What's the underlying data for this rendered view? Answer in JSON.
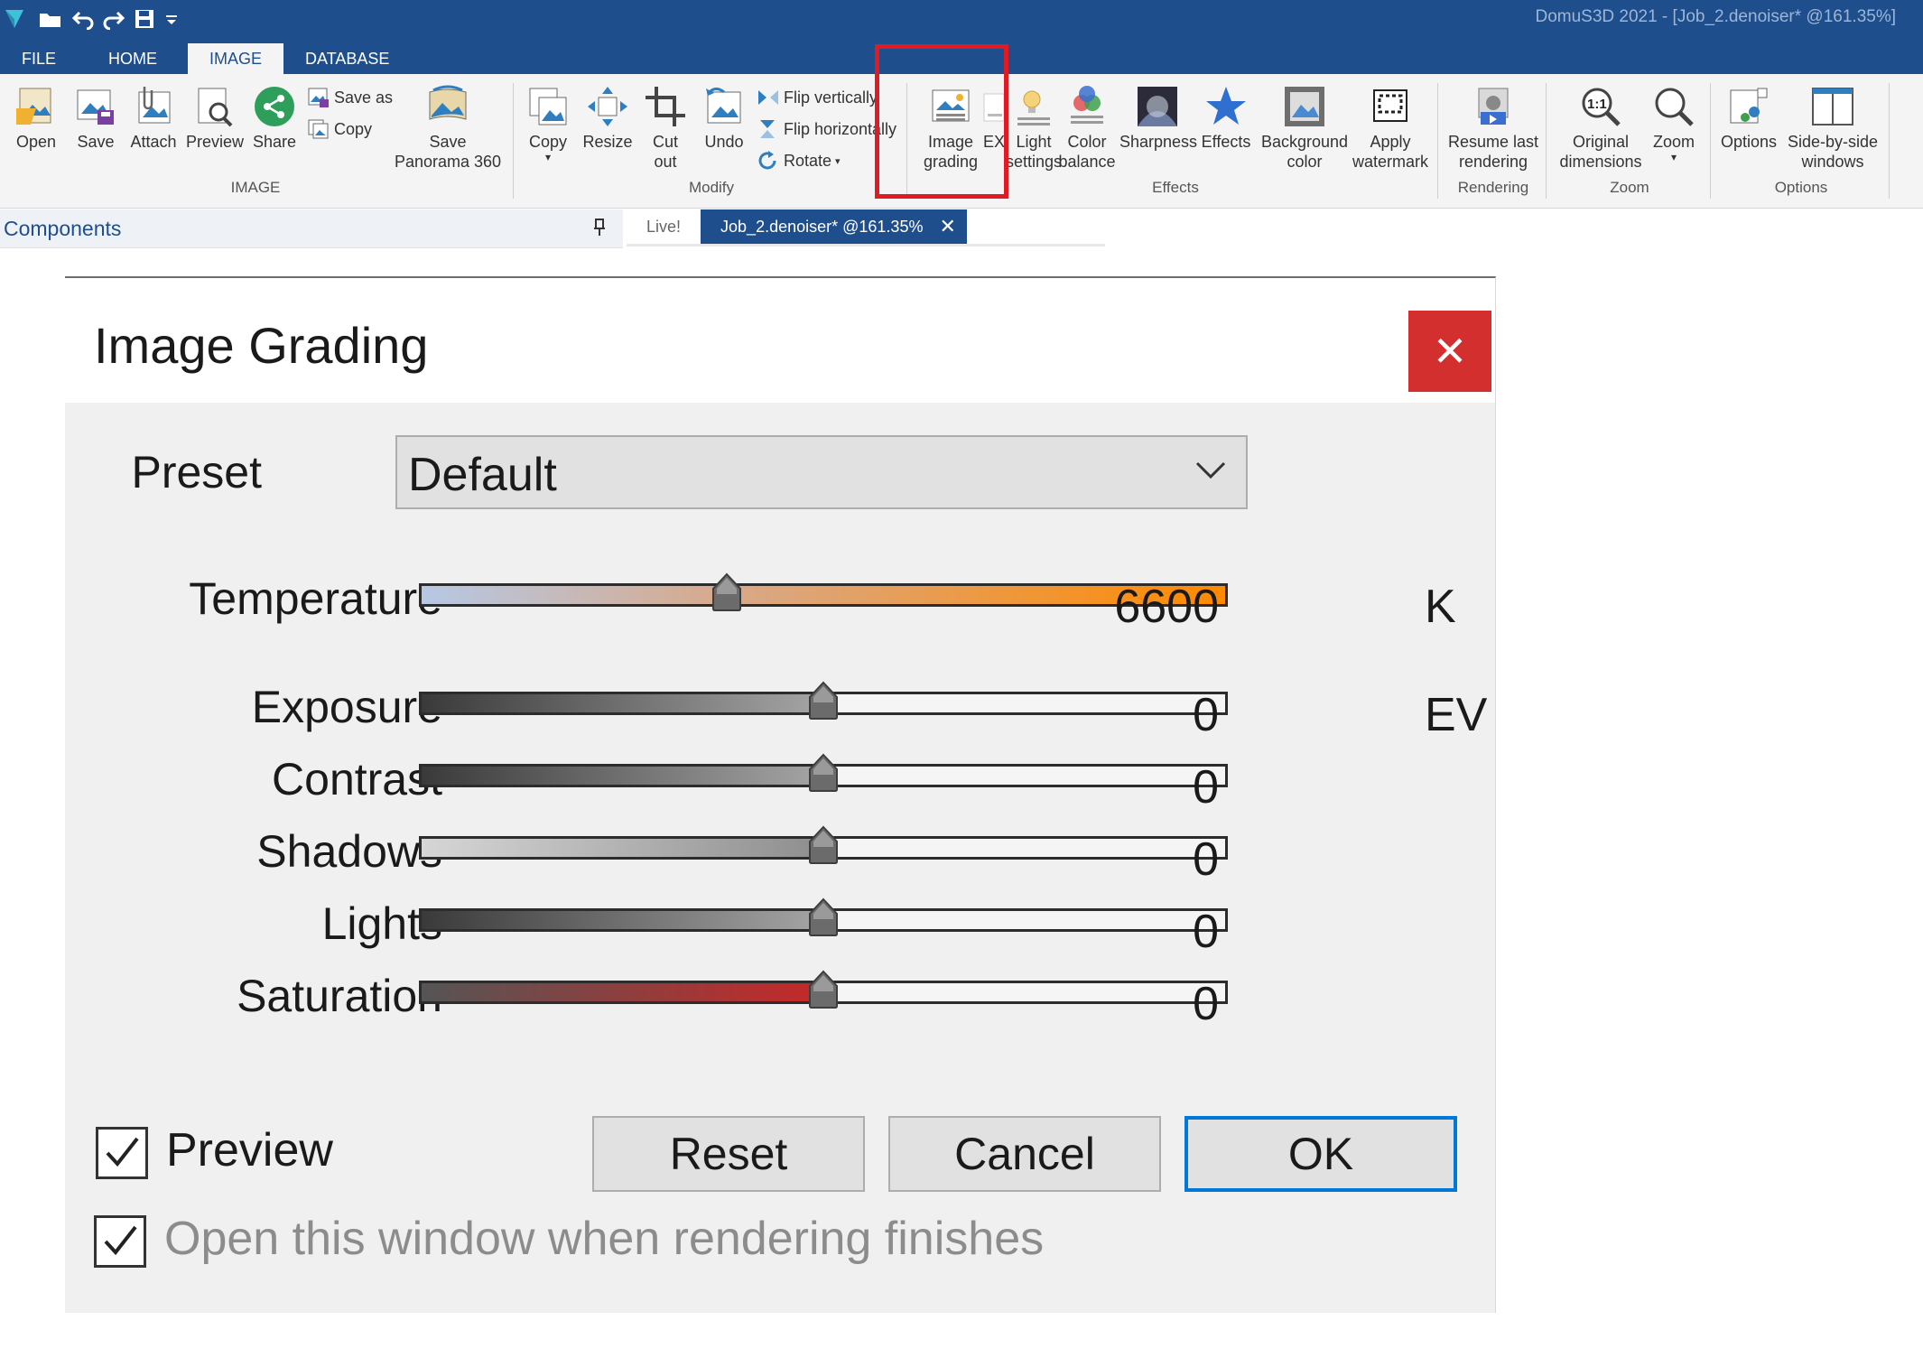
{
  "app": {
    "window_title": "DomuS3D 2021 - [Job_2.denoiser* @161.35%]"
  },
  "menu": {
    "tabs": [
      "FILE",
      "HOME",
      "IMAGE",
      "DATABASE"
    ],
    "active": "IMAGE"
  },
  "ribbon": {
    "image_group": {
      "label": "IMAGE",
      "open": "Open",
      "save": "Save",
      "attach": "Attach",
      "preview": "Preview",
      "share": "Share",
      "save_as": "Save as",
      "copy_small": "Copy",
      "save_panorama": "Save\nPanorama 360"
    },
    "modify_group": {
      "label": "Modify",
      "copy": "Copy",
      "resize": "Resize",
      "cut_out": "Cut\nout",
      "undo": "Undo",
      "flip_vertically": "Flip vertically",
      "flip_horizontally": "Flip horizontally",
      "rotate": "Rotate"
    },
    "effects_group": {
      "label": "Effects",
      "image_grading": "Image\ngrading",
      "exif": "EX",
      "light_settings": "Light\nsettings",
      "color_balance": "Color\nbalance",
      "sharpness": "Sharpness",
      "effects": "Effects",
      "background_color": "Background\ncolor",
      "apply_watermark": "Apply\nwatermark"
    },
    "rendering_group": {
      "label": "Rendering",
      "resume_last_rendering": "Resume last\nrendering"
    },
    "zoom_group": {
      "label": "Zoom",
      "original_dimensions": "Original\ndimensions",
      "zoom": "Zoom"
    },
    "options_group": {
      "label": "Options",
      "options": "Options",
      "side_by_side": "Side-by-side\nwindows"
    }
  },
  "components_panel": {
    "title": "Components"
  },
  "doc_tabs": {
    "live": "Live!",
    "active": "Job_2.denoiser* @161.35%"
  },
  "dialog": {
    "title": "Image Grading",
    "preset": {
      "label": "Preset",
      "value": "Default"
    },
    "sliders": [
      {
        "label": "Temperature",
        "value": "6600",
        "unit": "K",
        "position": 0.38
      },
      {
        "label": "Exposure",
        "value": "0",
        "unit": "EV",
        "position": 0.5
      },
      {
        "label": "Contrast",
        "value": "0",
        "unit": "",
        "position": 0.5
      },
      {
        "label": "Shadows",
        "value": "0",
        "unit": "",
        "position": 0.5
      },
      {
        "label": "Lights",
        "value": "0",
        "unit": "",
        "position": 0.5
      },
      {
        "label": "Saturation",
        "value": "0",
        "unit": "",
        "position": 0.5
      }
    ],
    "preview_checkbox": {
      "label": "Preview",
      "checked": true
    },
    "open_on_finish_checkbox": {
      "label": "Open this window when rendering finishes",
      "checked": true
    },
    "buttons": {
      "reset": "Reset",
      "cancel": "Cancel",
      "ok": "OK"
    }
  },
  "colors": {
    "titlebar": "#1f4e8c",
    "highlight_box": "#e01b24",
    "close_button": "#d32f2f",
    "ok_border": "#0078d7",
    "temperature_gradient": [
      "#b6c8e4",
      "#d8a98a",
      "#ff8a00"
    ],
    "saturation_fill": "#c62828"
  }
}
